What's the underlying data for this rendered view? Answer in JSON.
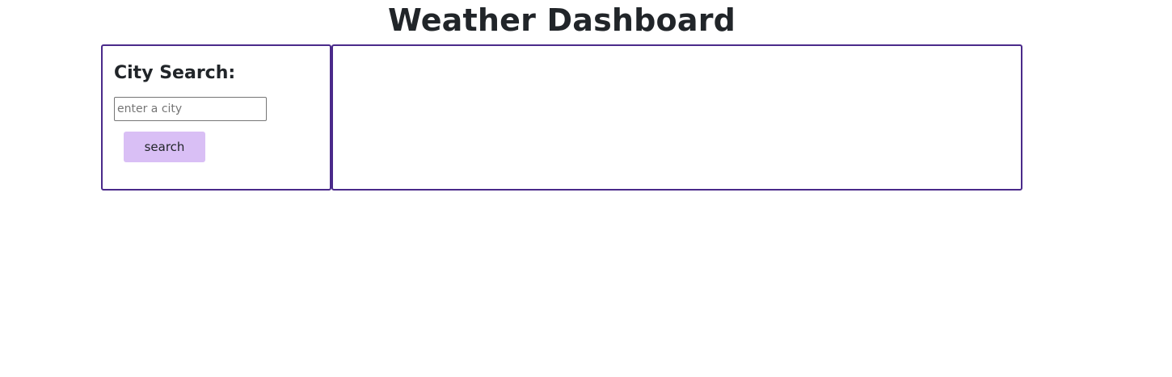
{
  "header": {
    "title": "Weather Dashboard"
  },
  "search_panel": {
    "heading": "City Search:",
    "input_value": "",
    "input_placeholder": "enter a city",
    "button_label": "search"
  },
  "results_panel": {},
  "colors": {
    "panel_border": "#4a2a8a",
    "button_background": "#d9bff5",
    "text": "#212529"
  }
}
